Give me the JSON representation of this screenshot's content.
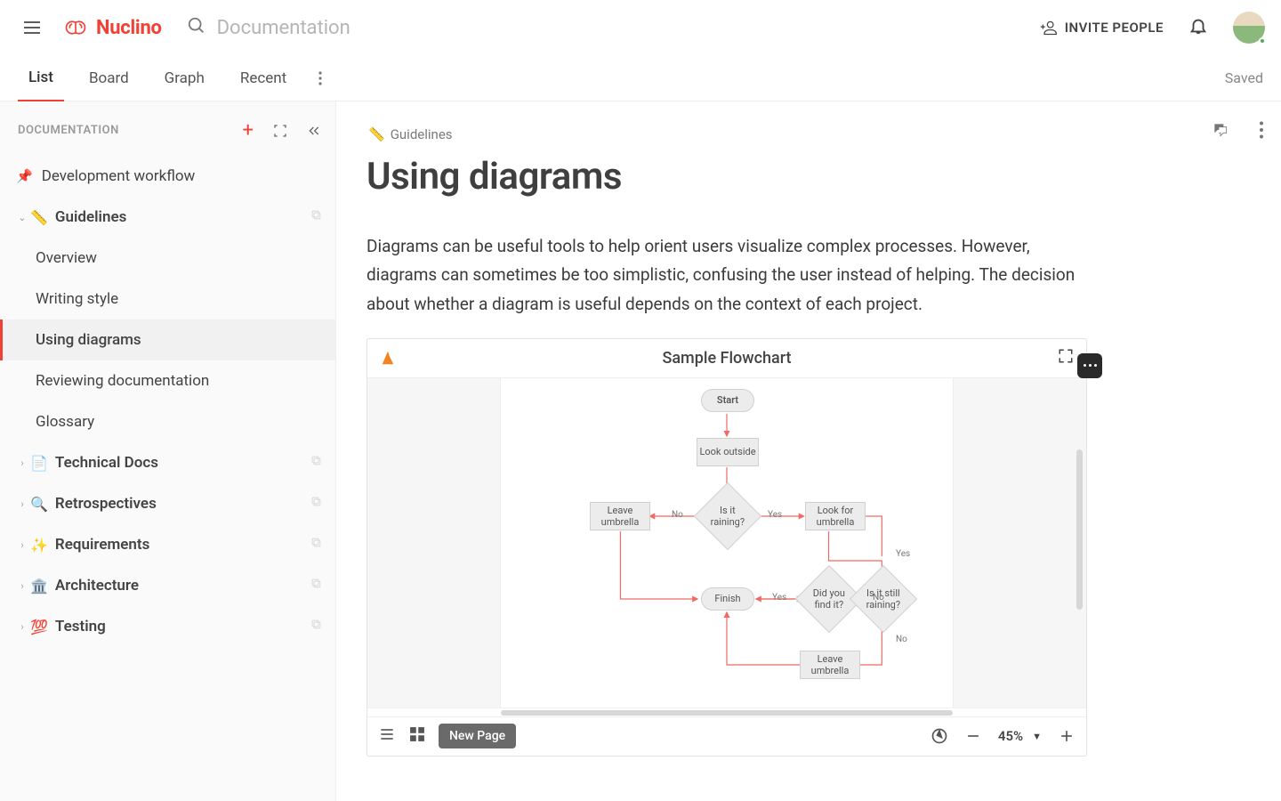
{
  "topbar": {
    "brand": "Nuclino",
    "search_placeholder": "Documentation",
    "invite_label": "INVITE PEOPLE"
  },
  "tabs": {
    "items": [
      "List",
      "Board",
      "Graph",
      "Recent"
    ],
    "active": 0,
    "status_right": "Saved"
  },
  "sidebar": {
    "heading": "DOCUMENTATION",
    "pinned": "Development workflow",
    "groups": [
      {
        "emoji": "📏",
        "label": "Guidelines",
        "expanded": true,
        "children": [
          "Overview",
          "Writing style",
          "Using diagrams",
          "Reviewing documentation",
          "Glossary"
        ],
        "selected_child": 2
      },
      {
        "emoji": "📄",
        "label": "Technical Docs"
      },
      {
        "emoji": "🔍",
        "label": "Retrospectives"
      },
      {
        "emoji": "✨",
        "label": "Requirements"
      },
      {
        "emoji": "🏛️",
        "label": "Architecture"
      },
      {
        "emoji": "💯",
        "label": "Testing"
      }
    ]
  },
  "page": {
    "breadcrumb_icon": "📏",
    "breadcrumb": "Guidelines",
    "title": "Using diagrams",
    "paragraph": "Diagrams can be useful tools to help orient users visualize complex processes. However, diagrams can sometimes be too simplistic, confusing the user instead of helping. The decision about whether a diagram is useful depends on the context of each project."
  },
  "embed": {
    "title": "Sample Flowchart",
    "new_page_label": "New Page",
    "zoom": "45%",
    "nodes": {
      "start": "Start",
      "look_outside": "Look outside",
      "is_raining": "Is it raining?",
      "leave_umbrella": "Leave umbrella",
      "look_for_umbrella": "Look for umbrella",
      "did_find": "Did you find it?",
      "still_raining": "Is it still raining?",
      "finish": "Finish",
      "leave_umbrella2": "Leave umbrella"
    },
    "labels": {
      "yes": "Yes",
      "no": "No"
    }
  }
}
